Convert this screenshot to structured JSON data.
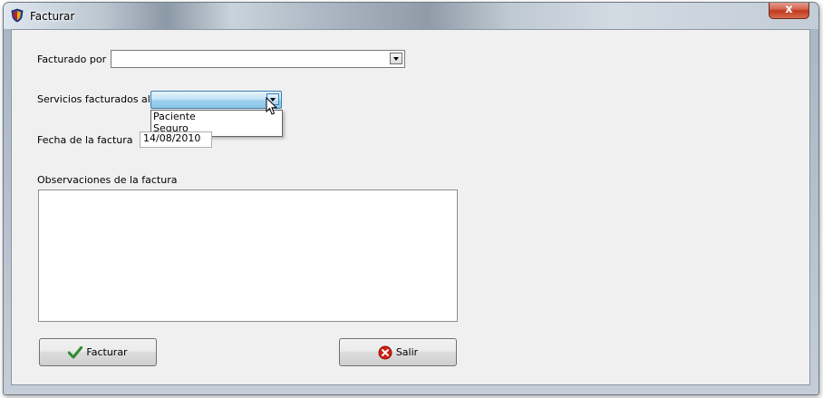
{
  "window": {
    "title": "Facturar",
    "close_glyph": "x"
  },
  "form": {
    "facturado_por": {
      "label": "Facturado por",
      "value": ""
    },
    "servicios": {
      "label": "Servicios facturados al",
      "value": "",
      "options": [
        "Paciente",
        "Seguro"
      ]
    },
    "fecha": {
      "label": "Fecha de la factura",
      "value": "14/08/2010"
    },
    "observaciones": {
      "label": "Observaciones de la factura",
      "value": ""
    }
  },
  "buttons": {
    "facturar": "Facturar",
    "salir": "Salir"
  },
  "icons": {
    "title": "app-shield-icon",
    "facturar": "checkmark-icon",
    "salir": "red-x-circle-icon",
    "cursor": "mouse-pointer-icon"
  },
  "colors": {
    "accent_green": "#2e8b2e",
    "accent_red": "#d02010",
    "highlight_blue": "#9cd0ef"
  }
}
